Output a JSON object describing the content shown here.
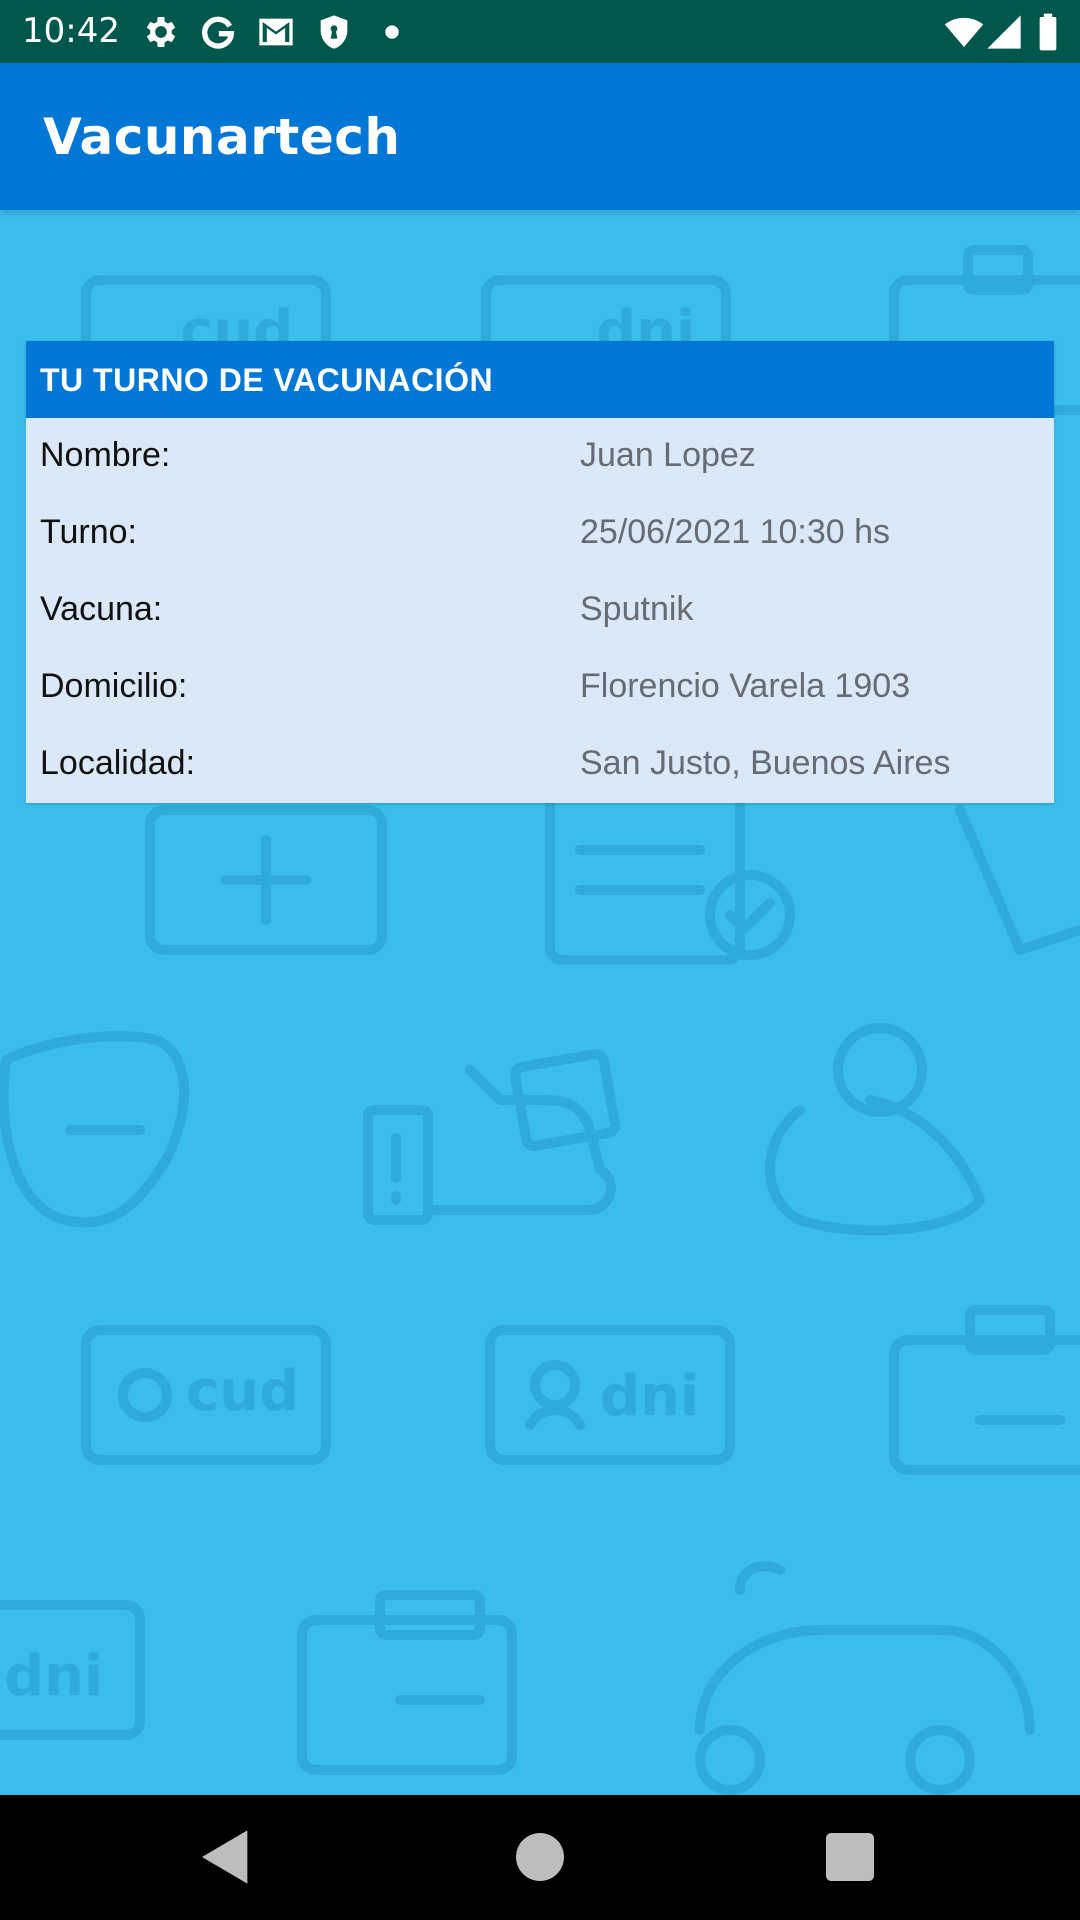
{
  "status_bar": {
    "time": "10:42",
    "icons": [
      "gear-icon",
      "google-icon",
      "gmail-icon",
      "shield-icon",
      "dot-icon",
      "wifi-icon",
      "signal-icon",
      "battery-icon"
    ]
  },
  "app_bar": {
    "title": "Vacunartech"
  },
  "card": {
    "title": "TU TURNO DE VACUNACIÓN",
    "rows": [
      {
        "label": "Nombre:",
        "value": "Juan Lopez"
      },
      {
        "label": "Turno:",
        "value": "25/06/2021 10:30 hs"
      },
      {
        "label": "Vacuna:",
        "value": "Sputnik"
      },
      {
        "label": "Domicilio:",
        "value": "Florencio Varela 1903"
      },
      {
        "label": "Localidad:",
        "value": "San Justo, Buenos Aires"
      }
    ]
  },
  "background": {
    "watermark_texts": [
      "cud",
      "dni",
      "cud",
      "dni",
      "dni"
    ]
  },
  "nav_bar": {
    "buttons": [
      "back-icon",
      "home-icon",
      "recents-icon"
    ]
  },
  "colors": {
    "status_bar": "#00574b",
    "primary": "#0277d5",
    "background": "#3bbdec",
    "card_body": "#dbe8f8",
    "value_text": "#676b73"
  }
}
